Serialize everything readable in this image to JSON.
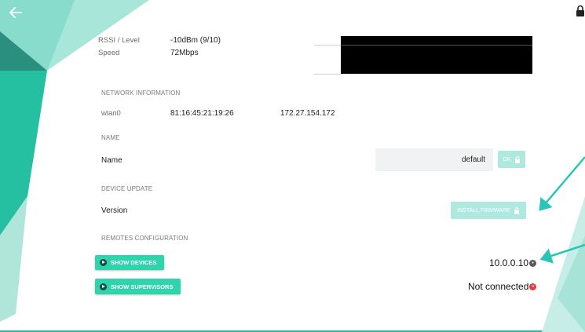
{
  "header": {
    "back_icon": "arrow-left-icon",
    "lock_icon": "lock-icon"
  },
  "signal": {
    "rssi_label": "RSSI / Level",
    "rssi_value": "-10dBm (9/10)",
    "speed_label": "Speed",
    "speed_value": "72Mbps"
  },
  "network": {
    "section_title": "NETWORK INFORMATION",
    "interface": "wlan0",
    "mac": "81:16:45:21:19:26",
    "ip": "172.27.154.172"
  },
  "name_section": {
    "section_title": "NAME",
    "label": "Name",
    "value": "default",
    "ok_label": "OK"
  },
  "update": {
    "section_title": "DEVICE UPDATE",
    "label": "Version",
    "install_label": "INSTALL FIRMWARE"
  },
  "remotes": {
    "section_title": "REMOTES CONFIGURATION",
    "show_devices_label": "SHOW DEVICES",
    "show_supervisors_label": "SHOW SUPERVISORS",
    "devices_status": "10.0.0.10",
    "supervisors_status": "Not connected"
  },
  "colors": {
    "accent": "#2fd4ad",
    "accent_disabled": "#aee8df",
    "teal_dark": "#1fa890",
    "error": "#e03a3a",
    "neutral_dot": "#5a5a5a"
  }
}
